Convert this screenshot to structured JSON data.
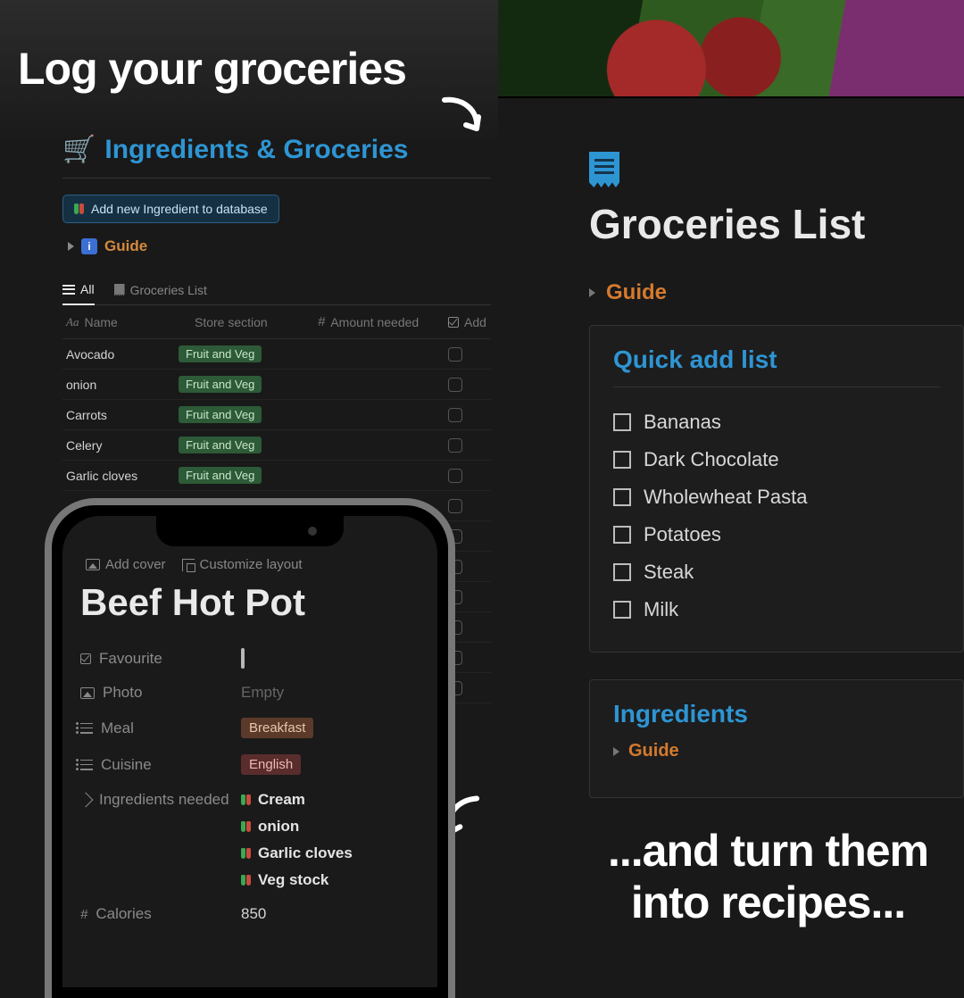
{
  "overlay": {
    "top": "Log your groceries",
    "bottom_line1": "...and turn them",
    "bottom_line2": "into recipes..."
  },
  "left": {
    "title": "Ingredients & Groceries",
    "add_button": "Add new Ingredient to database",
    "guide": "Guide",
    "tabs": {
      "all": "All",
      "groceries": "Groceries List"
    },
    "columns": {
      "name": "Name",
      "section": "Store section",
      "amount": "Amount needed",
      "add": "Add"
    },
    "rows": [
      {
        "name": "Avocado",
        "section": "Fruit and Veg"
      },
      {
        "name": "onion",
        "section": "Fruit and Veg"
      },
      {
        "name": "Carrots",
        "section": "Fruit and Veg"
      },
      {
        "name": "Celery",
        "section": "Fruit and Veg"
      },
      {
        "name": "Garlic cloves",
        "section": "Fruit and Veg"
      }
    ]
  },
  "right": {
    "title": "Groceries List",
    "guide": "Guide",
    "quick_add_heading": "Quick add list",
    "quick_add": [
      "Bananas",
      "Dark Chocolate",
      "Wholewheat Pasta",
      "Potatoes",
      "Steak",
      "Milk"
    ],
    "ingredients_heading": "Ingredients",
    "ingredients_guide": "Guide"
  },
  "phone": {
    "add_cover": "Add cover",
    "customize": "Customize layout",
    "recipe_title": "Beef Hot Pot",
    "props": {
      "favourite_label": "Favourite",
      "photo_label": "Photo",
      "photo_value": "Empty",
      "meal_label": "Meal",
      "meal_value": "Breakfast",
      "cuisine_label": "Cuisine",
      "cuisine_value": "English",
      "ingredients_label": "Ingredients needed",
      "ingredients": [
        "Cream",
        "onion",
        "Garlic cloves",
        "Veg stock"
      ],
      "calories_label": "Calories",
      "calories_value": "850"
    }
  }
}
